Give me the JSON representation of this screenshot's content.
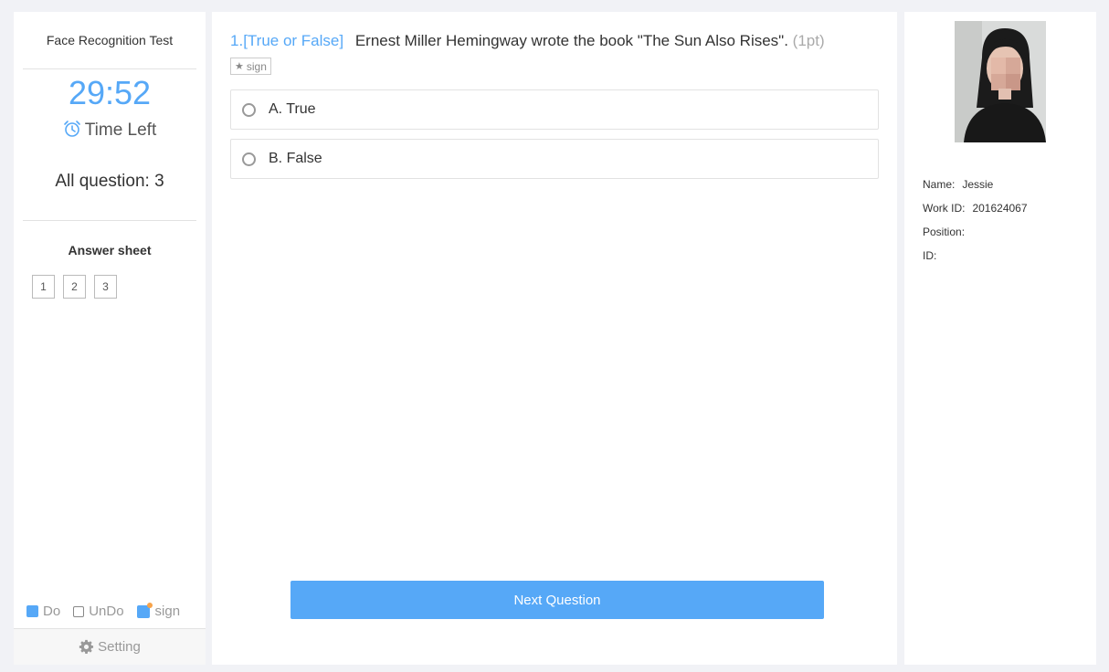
{
  "sidebar": {
    "exam_title": "Face Recognition Test",
    "timer": "29:52",
    "time_left_label": "Time Left",
    "all_questions": "All question: 3",
    "answer_sheet_title": "Answer sheet",
    "question_numbers": [
      "1",
      "2",
      "3"
    ],
    "legend": {
      "do_label": "Do",
      "undo_label": "UnDo",
      "sign_label": "sign"
    },
    "setting_label": "Setting"
  },
  "question": {
    "number": "1.",
    "type": "[True or False]",
    "text": "Ernest Miller Hemingway wrote the book \"The Sun Also Rises\".",
    "points": "(1pt)",
    "sign_label": "sign",
    "options": [
      {
        "label": "A. True"
      },
      {
        "label": "B. False"
      }
    ],
    "next_button": "Next Question"
  },
  "profile": {
    "name_label": "Name:",
    "name_value": "Jessie",
    "work_id_label": "Work ID:",
    "work_id_value": "201624067",
    "position_label": "Position:",
    "position_value": "",
    "id_label": "ID:",
    "id_value": ""
  },
  "colors": {
    "accent": "#56a8f7",
    "sign_dot": "#f7a34a",
    "background": "#f1f2f6"
  }
}
